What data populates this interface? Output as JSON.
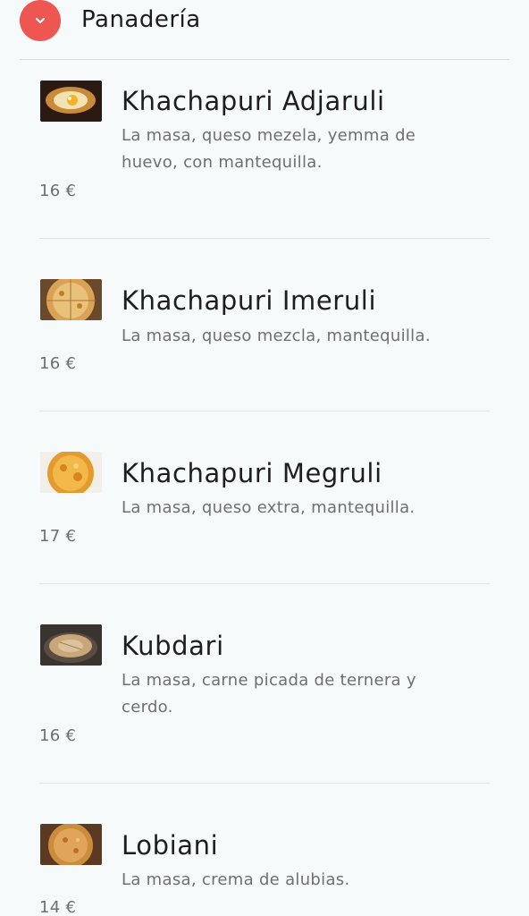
{
  "section": {
    "title": "Panadería",
    "toggle_icon": "chevron-down-icon",
    "accent_color": "#ee5652"
  },
  "items": [
    {
      "name": "Khachapuri Adjaruli",
      "description": "La masa, queso mezela, yemma de huevo, con mantequilla.",
      "price": "16 €",
      "image": "khachapuri-adjaruli-photo"
    },
    {
      "name": "Khachapuri Imeruli",
      "description": "La masa, queso mezcla, mantequilla.",
      "price": "16 €",
      "image": "khachapuri-imeruli-photo"
    },
    {
      "name": "Khachapuri Megruli",
      "description": "La masa, queso extra, mantequilla.",
      "price": "17 €",
      "image": "khachapuri-megruli-photo"
    },
    {
      "name": "Kubdari",
      "description": "La masa, carne picada de ternera y cerdo.",
      "price": "16 €",
      "image": "kubdari-photo"
    },
    {
      "name": "Lobiani",
      "description": "La masa, crema de alubias.",
      "price": "14 €",
      "image": "lobiani-photo"
    }
  ]
}
